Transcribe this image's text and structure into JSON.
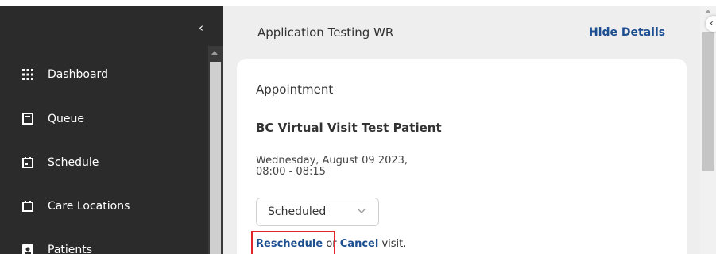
{
  "sidebar": {
    "collapse_glyph": "‹",
    "items": [
      {
        "label": "Dashboard",
        "icon": "grid-icon"
      },
      {
        "label": "Queue",
        "icon": "clipboard-icon"
      },
      {
        "label": "Schedule",
        "icon": "calendar-icon"
      },
      {
        "label": "Care Locations",
        "icon": "location-box-icon"
      },
      {
        "label": "Patients",
        "icon": "patient-badge-icon"
      }
    ]
  },
  "header": {
    "title": "Application Testing WR",
    "hide_details_label": "Hide Details"
  },
  "appointment": {
    "section_title": "Appointment",
    "patient_name": "BC Virtual Visit Test Patient",
    "date_line": "Wednesday, August 09 2023,",
    "time_line": "08:00 - 08:15",
    "status": {
      "selected": "Scheduled"
    },
    "actions": {
      "reschedule_label": "Reschedule",
      "or_text": " or ",
      "cancel_label": "Cancel",
      "suffix_text": " visit."
    }
  },
  "colors": {
    "sidebar_bg": "#2b2b2b",
    "content_bg": "#eeeeee",
    "link": "#1d4f91",
    "highlight": "#e2272b"
  }
}
